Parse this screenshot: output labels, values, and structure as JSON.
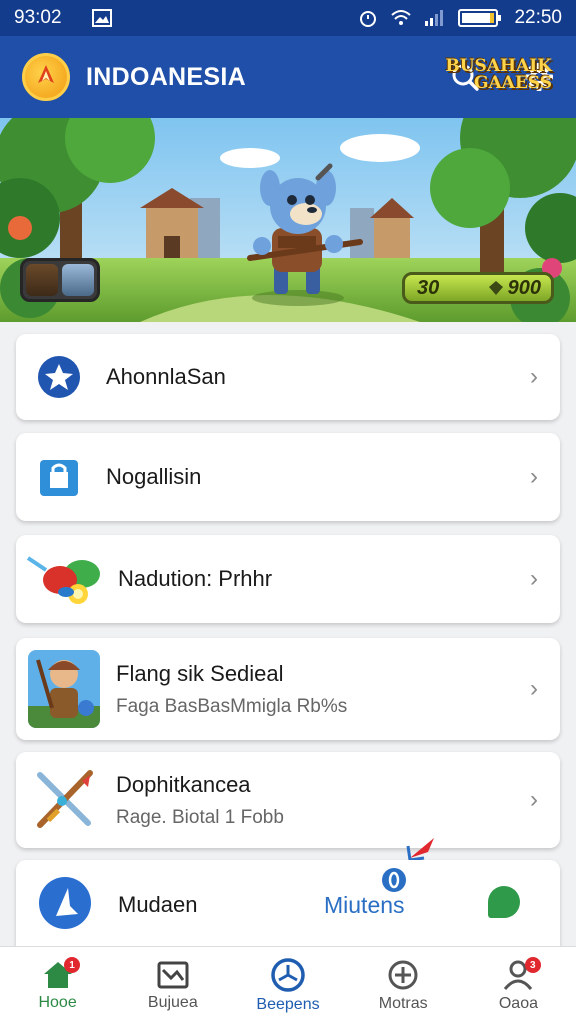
{
  "status_bar": {
    "time_left": "93:02",
    "time_right": "22:50"
  },
  "app_bar": {
    "title": "INDOANESIA",
    "actions": [
      "search-icon",
      "gear-icon"
    ]
  },
  "banner": {
    "brand_line1": "BUSAHAIK",
    "brand_line2": "GAAESS",
    "score_left": "30",
    "score_right": "900"
  },
  "menu": [
    {
      "title": "AhonnlaSan",
      "icon": "star-icon"
    },
    {
      "title": "Nogallisin",
      "icon": "bag-icon"
    },
    {
      "title": "Nadution: Prhhr",
      "icon": "fruit-icon"
    },
    {
      "title": "Flang sik Sedieal",
      "subtitle": "Faga BasBasMmigla Rb%s",
      "icon": "warrior-icon"
    },
    {
      "title": "Dophitkancea",
      "subtitle": "Rage. Biotal 1 Fobb",
      "icon": "crossed-swords-icon"
    }
  ],
  "bottom_card": {
    "label": "Mudaen",
    "center_label": "Miutens"
  },
  "tabs": [
    {
      "label": "Hooe",
      "badge": "1"
    },
    {
      "label": "Bujuea"
    },
    {
      "label": "Beepens"
    },
    {
      "label": "Motras"
    },
    {
      "label": "Oaoa",
      "badge": "3"
    }
  ],
  "colors": {
    "primary": "#1f4fa8",
    "status": "#143c8c",
    "accent_green": "#2d8a45",
    "badge_red": "#e0282e"
  }
}
